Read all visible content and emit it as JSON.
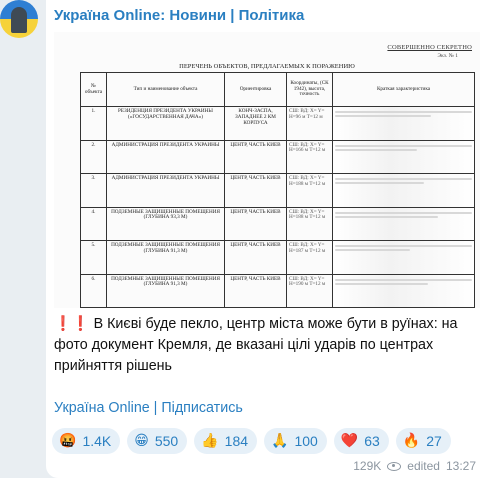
{
  "channel": {
    "name": "Україна Online: Новини | Політика"
  },
  "document": {
    "secret_label": "СОВЕРШЕННО СЕКРЕТНО",
    "annex_label": "Экз. № 1",
    "title": "ПЕРЕЧЕНЬ ОБЪЕКТОВ, ПРЕДЛАГАЕМЫХ К ПОРАЖЕНИЮ",
    "headers": [
      "№ объекта",
      "Тип и наименование объекта",
      "Ориентировка",
      "Координаты, (СК 1942), высота, точность",
      "Краткая характеристика"
    ],
    "rows": [
      {
        "num": "1.",
        "name": "РЕЗИДЕНЦИЯ ПРЕЗИДЕНТА УКРАИНЫ («ГОСУДАРСТВЕННАЯ ДАЧА»)",
        "orient": "КОНЧ-ЗАСПА, ЗАПАДНЕЕ 2 КМ КОРПУСА",
        "coords": "СШ: ВД: X= Y= H=96 м Т=12 м"
      },
      {
        "num": "2.",
        "name": "АДМИНИСТРАЦИЯ ПРЕЗИДЕНТА УКРАИНЫ",
        "orient": "ЦЕНТР, ЧАСТЬ КИЕВ",
        "coords": "СШ: ВД: X= Y= H=166 м Т=12 м"
      },
      {
        "num": "3.",
        "name": "АДМИНИСТРАЦИЯ ПРЕЗИДЕНТА УКРАИНЫ",
        "orient": "ЦЕНТР, ЧАСТЬ КИЕВ",
        "coords": "СШ: ВД: X= Y= H=188 м Т=12 м"
      },
      {
        "num": "4.",
        "name": "ПОДЗЕМНЫЕ ЗАЩИЩЕННЫЕ ПОМЕЩЕНИЯ (ГЛУБИНА 93,3 М)",
        "orient": "ЦЕНТР, ЧАСТЬ КИЕВ",
        "coords": "СШ: ВД: X= Y= H=188 м Т=12 м"
      },
      {
        "num": "5.",
        "name": "ПОДЗЕМНЫЕ ЗАЩИЩЕННЫЕ ПОМЕЩЕНИЯ (ГЛУБИНА 91,3 М)",
        "orient": "ЦЕНТР, ЧАСТЬ КИЕВ",
        "coords": "СШ: ВД: X= Y= H=187 м Т=12 м"
      },
      {
        "num": "6.",
        "name": "ПОДЗЕМНЫЕ ЗАЩИЩЕННЫЕ ПОМЕЩЕНИЯ (ГЛУБИНА 91,3 М)",
        "orient": "ЦЕНТР, ЧАСТЬ КИЕВ",
        "coords": "СШ: ВД: X= Y= H=190 м Т=12 м"
      }
    ]
  },
  "post": {
    "emoji_prefix": "❗️❗️",
    "text": "В Києві буде пекло, центр міста може бути в руїнах: на фото документ Кремля, де вказані цілі ударів по центрах прийняття рішень",
    "link": "Україна Online | Підписатись"
  },
  "reactions": [
    {
      "emoji": "🤬",
      "count": "1.4K",
      "icon": "angry-face-icon"
    },
    {
      "emoji": "😁",
      "count": "550",
      "icon": "grin-face-icon"
    },
    {
      "emoji": "👍",
      "count": "184",
      "icon": "thumbs-up-icon"
    },
    {
      "emoji": "🙏",
      "count": "100",
      "icon": "pray-icon"
    },
    {
      "emoji": "❤️",
      "count": "63",
      "icon": "heart-icon"
    },
    {
      "emoji": "🔥",
      "count": "27",
      "icon": "fire-icon"
    }
  ],
  "meta": {
    "views": "129K",
    "edited": "edited",
    "time": "13:27"
  },
  "colors": {
    "accent": "#2a7fc1",
    "background": "#e9eef2",
    "reaction_bg": "#e6f0f8"
  }
}
